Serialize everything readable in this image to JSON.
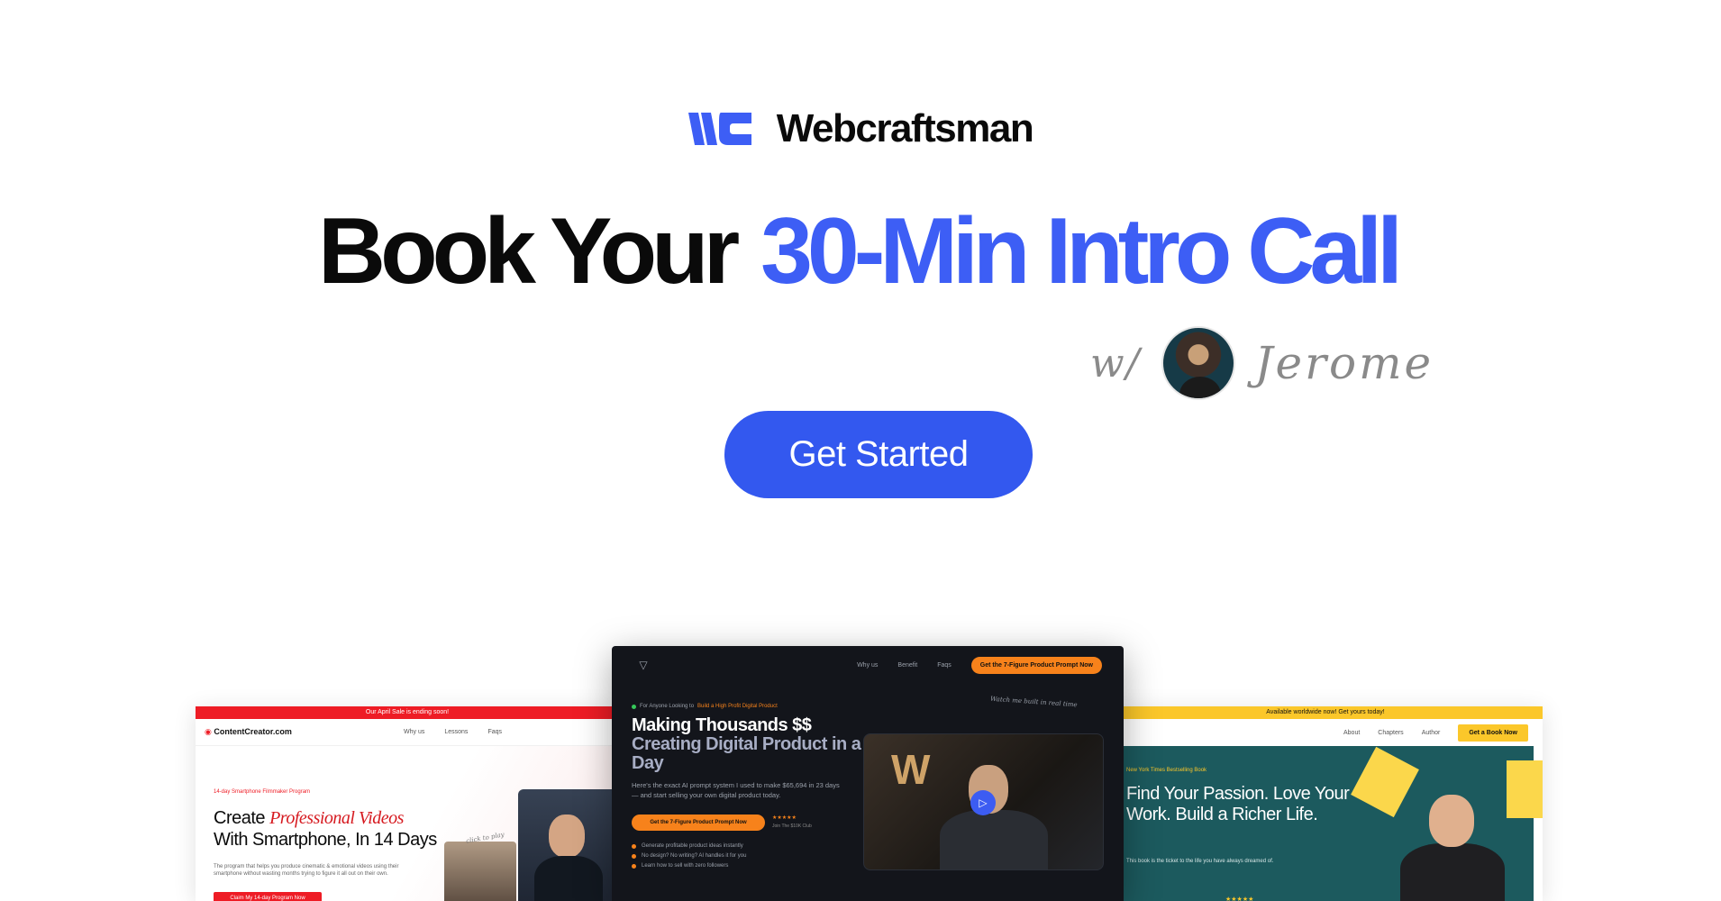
{
  "brand": {
    "name": "Webcraftsman",
    "accent": "#3d5ef5"
  },
  "hero": {
    "headline_plain": "Book Your",
    "headline_highlight": "30-Min Intro Call",
    "host_prefix": "w/",
    "host_name": "Jerome",
    "cta_label": "Get Started",
    "cta_color": "#3358ef"
  },
  "previews": {
    "left": {
      "banner": "Our April Sale is ending soon!",
      "logo_text": "ContentCreator",
      "logo_suffix": ".com",
      "nav": [
        "Why us",
        "Lessons",
        "Faqs"
      ],
      "kicker": "14-day Smartphone Filmmaker Program",
      "title_a": "Create",
      "title_em": "Professional Videos",
      "title_b": "With Smartphone, In 14 Days",
      "desc": "The program that helps you produce cinematic & emotional videos using their smartphone without wasting months trying to figure it all out on their own.",
      "cta": "Claim My 14-day Program Now",
      "note": "click to play"
    },
    "center": {
      "nav": [
        "Why us",
        "Benefit",
        "Faqs"
      ],
      "nav_cta": "Get the 7-Figure Product Prompt Now",
      "kicker_a": "For Anyone Looking to",
      "kicker_b": "Build a High Profit Digital Product",
      "title_a": "Making Thousands $$",
      "title_b": "Creating Digital Product in a Day",
      "desc": "Here's the exact AI prompt system I used to make $65,694 in 23 days — and start selling your own digital product today.",
      "cta": "Get the 7-Figure Product Prompt Now",
      "stars": "★★★★★",
      "club": "Join The $10K Club",
      "list": [
        "Generate profitable product ideas instantly",
        "No design? No writing? AI handles it for you",
        "Learn how to sell with zero followers"
      ],
      "note": "Watch me built in real time"
    },
    "right": {
      "banner": "Available worldwide now! Get yours today!",
      "nav": [
        "About",
        "Chapters",
        "Author"
      ],
      "nav_cta": "Get a Book Now",
      "kicker": "New York Times Bestselling Book",
      "title": "Find Your Passion. Love Your Work. Build a Richer Life.",
      "desc": "This book is the ticket to the life you have always dreamed of.",
      "stars": "★★★★★"
    }
  }
}
